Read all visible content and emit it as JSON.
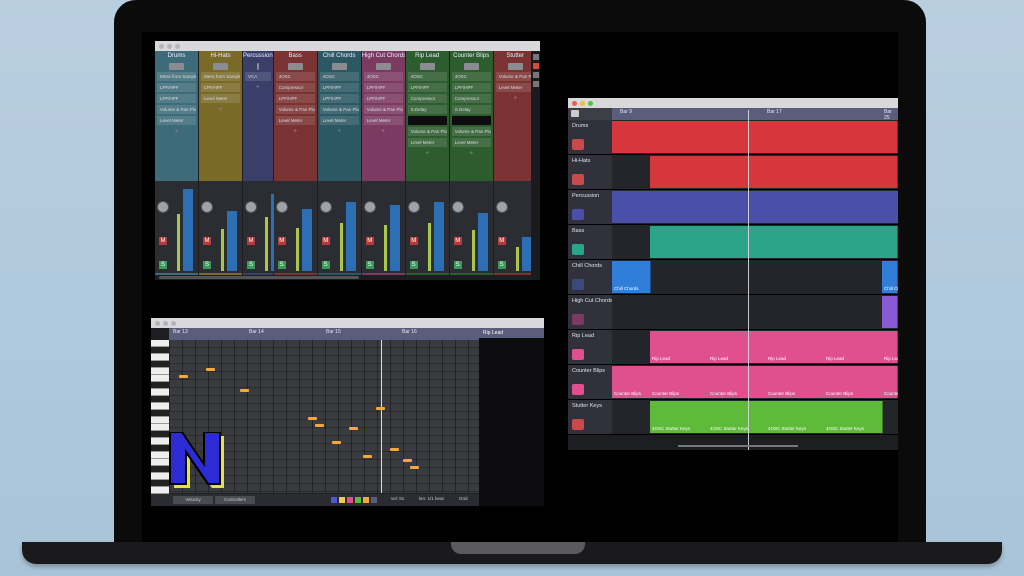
{
  "mixer": {
    "channels": [
      {
        "name": "Drums",
        "color": "#3d6b79",
        "plugins": [
          "Mess from Sampler",
          "LPF/HPF",
          "LPF/HPF",
          "Volume & Pan Plugin",
          "Level Meter"
        ]
      },
      {
        "name": "Hi-Hats",
        "color": "#7a6a28",
        "plugins": [
          "Mess from Sampler",
          "LPF/HPF",
          "Level Meter"
        ]
      },
      {
        "name": "Percussion",
        "color": "#3a3f6a",
        "plugins": [
          "VCA"
        ]
      },
      {
        "name": "Bass",
        "color": "#7a3232",
        "plugins": [
          "4OSC",
          "Compressor",
          "LPF/HPF",
          "Volume & Pan Plugin",
          "Level Meter"
        ]
      },
      {
        "name": "Chill Chords",
        "color": "#2c5864",
        "plugins": [
          "4OSC",
          "LPF/HPF",
          "LPF/HPF",
          "Volume & Pan Plugin",
          "Level Meter"
        ]
      },
      {
        "name": "High Cut Chords",
        "color": "#7a3a62",
        "plugins": [
          "4OSC",
          "LPF/HPF",
          "LPF/HPF",
          "Volume & Pan Plugin",
          "Level Meter"
        ]
      },
      {
        "name": "Rip Lead",
        "color": "#2d5c2e",
        "plugins": [
          "4OSC",
          "LPF/HPF",
          "Compressor",
          "S.Delay",
          "",
          "Volume & Pan Plugin",
          "Level Meter"
        ]
      },
      {
        "name": "Counter Blips",
        "color": "#2d5c2e",
        "plugins": [
          "4OSC",
          "LPF/HPF",
          "Compressor",
          "S.Delay",
          "",
          "Volume & Pan Plugin",
          "Level Meter"
        ]
      },
      {
        "name": "Stutter",
        "color": "#7a3232",
        "plugins": [
          "Volume & Pan Plugin",
          "Level Meter"
        ]
      }
    ],
    "meters": [
      0.95,
      0.7,
      0.9,
      0.72,
      0.8,
      0.77,
      0.8,
      0.68,
      0.4
    ]
  },
  "arrange": {
    "bar_labels": [
      "Bar 9",
      "Bar 17",
      "Bar 25"
    ],
    "tracks": [
      {
        "name": "Drums",
        "color": "#d6373d",
        "icon_color": "#c84a4a"
      },
      {
        "name": "Hi-Hats",
        "color": "#d6373d",
        "icon_color": "#c84a4a"
      },
      {
        "name": "Percussion",
        "color": "#4a4fa8",
        "icon_color": "#4a4fa8"
      },
      {
        "name": "Bass",
        "color": "#2aa58a",
        "icon_color": "#2aa58a"
      },
      {
        "name": "Chill Chords",
        "color": "#2f7fd8",
        "icon_color": "#3a4a7a",
        "clip_label": "Chill Chords"
      },
      {
        "name": "High Cut Chords",
        "color": "#8a5ad6",
        "icon_color": "#7a3a62"
      },
      {
        "name": "Rip Lead",
        "color": "#e0508f",
        "icon_color": "#e0508f",
        "clip_label": "Rip Lead"
      },
      {
        "name": "Counter Blips",
        "color": "#e0508f",
        "icon_color": "#e0508f",
        "clip_label": "Counter Blips"
      },
      {
        "name": "Stutter Keys",
        "color": "#5fba3c",
        "icon_color": "#c84a4a",
        "clip_label": "4OSC Stutter Keys"
      }
    ]
  },
  "piano_roll": {
    "bar_labels": [
      "Bar 13",
      "Bar 14",
      "Bar 15",
      "Bar 16"
    ],
    "clip_name": "Rip Lead",
    "bottom": {
      "velocity": "Velocity",
      "controllers": "Controllers",
      "vel": "vel: 81",
      "len": "len: 1/1 beat",
      "grid": "Grid"
    },
    "swatches": [
      "#4a5ad6",
      "#f2c94c",
      "#e0508f",
      "#5fba3c",
      "#f2a93b",
      "#5b5d7c"
    ],
    "notes": [
      {
        "beat": 0.0,
        "pitch": 0.25
      },
      {
        "beat": 0.4,
        "pitch": 0.2
      },
      {
        "beat": 0.9,
        "pitch": 0.35
      },
      {
        "beat": 1.9,
        "pitch": 0.55
      },
      {
        "beat": 2.0,
        "pitch": 0.6
      },
      {
        "beat": 2.25,
        "pitch": 0.72
      },
      {
        "beat": 2.5,
        "pitch": 0.62
      },
      {
        "beat": 2.7,
        "pitch": 0.82
      },
      {
        "beat": 2.9,
        "pitch": 0.48
      },
      {
        "beat": 3.1,
        "pitch": 0.77
      },
      {
        "beat": 3.3,
        "pitch": 0.85
      },
      {
        "beat": 3.4,
        "pitch": 0.9
      }
    ]
  },
  "logo": {
    "letter": "N",
    "fill": "#2d2bd6",
    "shadow": "#e8e04a"
  }
}
